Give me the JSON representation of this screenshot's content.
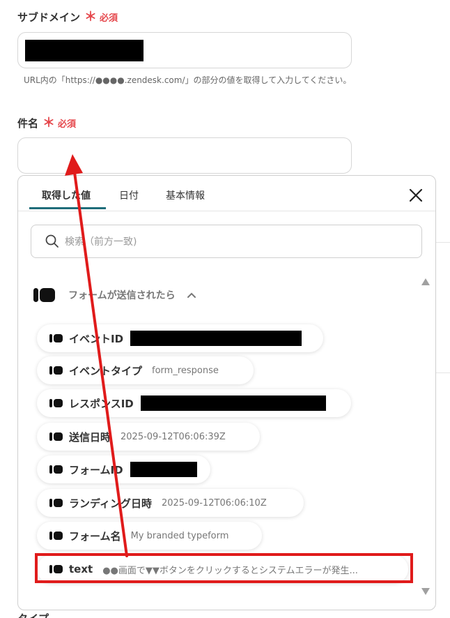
{
  "subdomain": {
    "label": "サブドメイン",
    "required_mark": "＊",
    "required_text": "必須",
    "help": "URL内の「https://●●●●.zendesk.com/」の部分の値を取得して入力してください。"
  },
  "subject": {
    "label": "件名",
    "required_mark": "＊",
    "required_text": "必須"
  },
  "panel": {
    "tabs": [
      "取得した値",
      "日付",
      "基本情報"
    ],
    "search_placeholder": "検索（前方一致)",
    "group_title": "フォームが送信されたら",
    "items": [
      {
        "name": "イベントID",
        "value": ""
      },
      {
        "name": "イベントタイプ",
        "value": "form_response"
      },
      {
        "name": "レスポンスID",
        "value": ""
      },
      {
        "name": "送信日時",
        "value": "2025-09-12T06:06:39Z"
      },
      {
        "name": "フォームID",
        "value": ""
      },
      {
        "name": "ランディング日時",
        "value": "2025-09-12T06:06:10Z"
      },
      {
        "name": "フォーム名",
        "value": "My branded typeform"
      },
      {
        "name": "text",
        "value": "●●画面で▼▼ボタンをクリックするとシステムエラーが発生..."
      }
    ]
  },
  "next_field_label": "タイプ",
  "colors": {
    "required": "#e5484d",
    "tab_accent": "#1f6d7a",
    "annotation": "#e01b1b"
  }
}
